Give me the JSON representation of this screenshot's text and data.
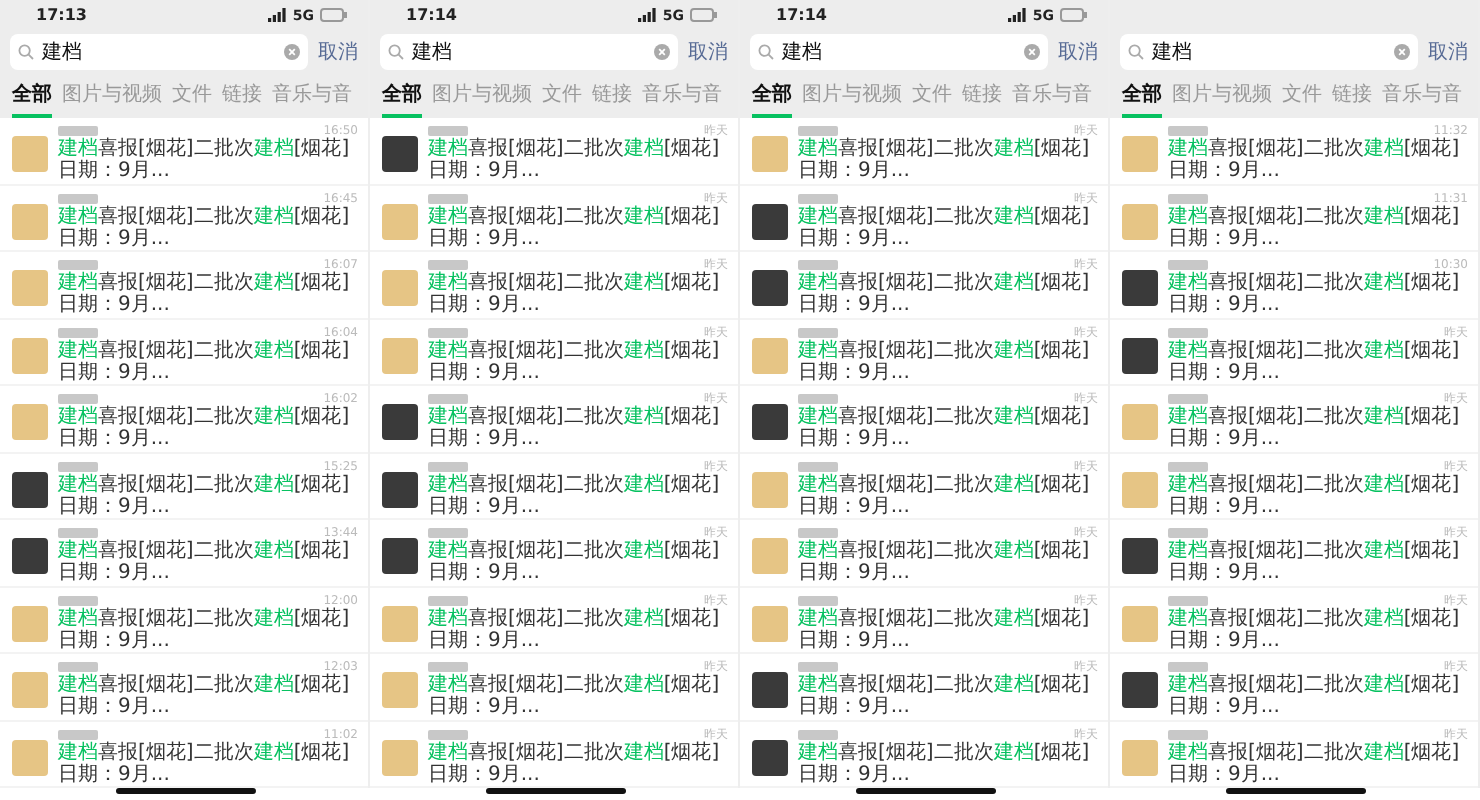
{
  "panels": [
    {
      "time": "17:13",
      "network": "5G",
      "query": "建档",
      "cancel": "取消",
      "tabs": [
        {
          "label": "全部",
          "selected": true
        },
        {
          "label": "图片与视频",
          "selected": false
        },
        {
          "label": "文件",
          "selected": false
        },
        {
          "label": "链接",
          "selected": false
        },
        {
          "label": "音乐与音",
          "selected": false
        }
      ],
      "results": [
        {
          "color": "#e6c585",
          "time": "16:50",
          "message": [
            {
              "text": "建档",
              "hit": true
            },
            {
              "text": "喜报[烟花]二批次",
              "hit": false
            },
            {
              "text": "建档",
              "hit": true
            },
            {
              "text": "[烟花]日期：9月...",
              "hit": false
            }
          ]
        },
        {
          "color": "#e6c585",
          "time": "16:45",
          "message": [
            {
              "text": "建档",
              "hit": true
            },
            {
              "text": "喜报[烟花]二批次",
              "hit": false
            },
            {
              "text": "建档",
              "hit": true
            },
            {
              "text": "[烟花]日期：9月...",
              "hit": false
            }
          ]
        },
        {
          "color": "#e6c585",
          "time": "16:07",
          "message": [
            {
              "text": "建档",
              "hit": true
            },
            {
              "text": "喜报[烟花]二批次",
              "hit": false
            },
            {
              "text": "建档",
              "hit": true
            },
            {
              "text": "[烟花]日期：9月...",
              "hit": false
            }
          ]
        },
        {
          "color": "#e6c585",
          "time": "16:04",
          "message": [
            {
              "text": "建档",
              "hit": true
            },
            {
              "text": "喜报[烟花]二批次",
              "hit": false
            },
            {
              "text": "建档",
              "hit": true
            },
            {
              "text": "[烟花]日期：9月...",
              "hit": false
            }
          ]
        },
        {
          "color": "#e6c585",
          "time": "16:02",
          "message": [
            {
              "text": "建档",
              "hit": true
            },
            {
              "text": "喜报[烟花]二批次",
              "hit": false
            },
            {
              "text": "建档",
              "hit": true
            },
            {
              "text": "[烟花]日期：9月...",
              "hit": false
            }
          ]
        },
        {
          "color": "#3a3a3a",
          "time": "15:25",
          "message": [
            {
              "text": "建档",
              "hit": true
            },
            {
              "text": "喜报[烟花]二批次",
              "hit": false
            },
            {
              "text": "建档",
              "hit": true
            },
            {
              "text": "[烟花]日期：9月...",
              "hit": false
            }
          ]
        },
        {
          "color": "#3a3a3a",
          "time": "13:44",
          "message": [
            {
              "text": "建档",
              "hit": true
            },
            {
              "text": "喜报[烟花]二批次",
              "hit": false
            },
            {
              "text": "建档",
              "hit": true
            },
            {
              "text": "[烟花]日期：9月...",
              "hit": false
            }
          ]
        },
        {
          "color": "#e6c585",
          "time": "12:00",
          "message": [
            {
              "text": "建档",
              "hit": true
            },
            {
              "text": "喜报[烟花]二批次",
              "hit": false
            },
            {
              "text": "建档",
              "hit": true
            },
            {
              "text": "[烟花]日期：9月...",
              "hit": false
            }
          ]
        },
        {
          "color": "#e6c585",
          "time": "12:03",
          "message": [
            {
              "text": "建档",
              "hit": true
            },
            {
              "text": "喜报[烟花]二批次",
              "hit": false
            },
            {
              "text": "建档",
              "hit": true
            },
            {
              "text": "[烟花]日期：9月...",
              "hit": false
            }
          ]
        },
        {
          "color": "#e6c585",
          "time": "11:02",
          "message": [
            {
              "text": "建档",
              "hit": true
            },
            {
              "text": "喜报[烟花]二批次",
              "hit": false
            },
            {
              "text": "建档",
              "hit": true
            },
            {
              "text": "[烟花]日期：9月...",
              "hit": false
            }
          ]
        }
      ]
    },
    {
      "time": "17:14",
      "network": "5G",
      "query": "建档",
      "cancel": "取消",
      "tabs": [
        {
          "label": "全部",
          "selected": true
        },
        {
          "label": "图片与视频",
          "selected": false
        },
        {
          "label": "文件",
          "selected": false
        },
        {
          "label": "链接",
          "selected": false
        },
        {
          "label": "音乐与音",
          "selected": false
        }
      ],
      "results": [
        {
          "color": "#3a3a3a",
          "time": "昨天",
          "message": [
            {
              "text": "建档",
              "hit": true
            },
            {
              "text": "喜报[烟花]二批次",
              "hit": false
            },
            {
              "text": "建档",
              "hit": true
            },
            {
              "text": "[烟花]日期：9月...",
              "hit": false
            }
          ]
        },
        {
          "color": "#e6c585",
          "time": "昨天",
          "message": [
            {
              "text": "建档",
              "hit": true
            },
            {
              "text": "喜报[烟花]二批次",
              "hit": false
            },
            {
              "text": "建档",
              "hit": true
            },
            {
              "text": "[烟花]日期：9月...",
              "hit": false
            }
          ]
        },
        {
          "color": "#e6c585",
          "time": "昨天",
          "message": [
            {
              "text": "建档",
              "hit": true
            },
            {
              "text": "喜报[烟花]二批次",
              "hit": false
            },
            {
              "text": "建档",
              "hit": true
            },
            {
              "text": "[烟花]日期：9月...",
              "hit": false
            }
          ]
        },
        {
          "color": "#e6c585",
          "time": "昨天",
          "message": [
            {
              "text": "建档",
              "hit": true
            },
            {
              "text": "喜报[烟花]二批次",
              "hit": false
            },
            {
              "text": "建档",
              "hit": true
            },
            {
              "text": "[烟花]日期：9月...",
              "hit": false
            }
          ]
        },
        {
          "color": "#3a3a3a",
          "time": "昨天",
          "message": [
            {
              "text": "建档",
              "hit": true
            },
            {
              "text": "喜报[烟花]二批次",
              "hit": false
            },
            {
              "text": "建档",
              "hit": true
            },
            {
              "text": "[烟花]日期：9月...",
              "hit": false
            }
          ]
        },
        {
          "color": "#3a3a3a",
          "time": "昨天",
          "message": [
            {
              "text": "建档",
              "hit": true
            },
            {
              "text": "喜报[烟花]二批次",
              "hit": false
            },
            {
              "text": "建档",
              "hit": true
            },
            {
              "text": "[烟花]日期：9月...",
              "hit": false
            }
          ]
        },
        {
          "color": "#3a3a3a",
          "time": "昨天",
          "message": [
            {
              "text": "建档",
              "hit": true
            },
            {
              "text": "喜报[烟花]二批次",
              "hit": false
            },
            {
              "text": "建档",
              "hit": true
            },
            {
              "text": "[烟花]日期：9月...",
              "hit": false
            }
          ]
        },
        {
          "color": "#e6c585",
          "time": "昨天",
          "message": [
            {
              "text": "建档",
              "hit": true
            },
            {
              "text": "喜报[烟花]二批次",
              "hit": false
            },
            {
              "text": "建档",
              "hit": true
            },
            {
              "text": "[烟花]日期：9月...",
              "hit": false
            }
          ]
        },
        {
          "color": "#e6c585",
          "time": "昨天",
          "message": [
            {
              "text": "建档",
              "hit": true
            },
            {
              "text": "喜报[烟花]二批次",
              "hit": false
            },
            {
              "text": "建档",
              "hit": true
            },
            {
              "text": "[烟花]日期：9月...",
              "hit": false
            }
          ]
        },
        {
          "color": "#e6c585",
          "time": "昨天",
          "message": [
            {
              "text": "建档",
              "hit": true
            },
            {
              "text": "喜报[烟花]二批次",
              "hit": false
            },
            {
              "text": "建档",
              "hit": true
            },
            {
              "text": "[烟花]日期：9月...",
              "hit": false
            }
          ]
        }
      ]
    },
    {
      "time": "17:14",
      "network": "5G",
      "query": "建档",
      "cancel": "取消",
      "tabs": [
        {
          "label": "全部",
          "selected": true
        },
        {
          "label": "图片与视频",
          "selected": false
        },
        {
          "label": "文件",
          "selected": false
        },
        {
          "label": "链接",
          "selected": false
        },
        {
          "label": "音乐与音",
          "selected": false
        }
      ],
      "results": [
        {
          "color": "#e6c585",
          "time": "昨天",
          "message": [
            {
              "text": "建档",
              "hit": true
            },
            {
              "text": "喜报[烟花]二批次",
              "hit": false
            },
            {
              "text": "建档",
              "hit": true
            },
            {
              "text": "[烟花]日期：9月...",
              "hit": false
            }
          ]
        },
        {
          "color": "#3a3a3a",
          "time": "昨天",
          "message": [
            {
              "text": "建档",
              "hit": true
            },
            {
              "text": "喜报[烟花]二批次",
              "hit": false
            },
            {
              "text": "建档",
              "hit": true
            },
            {
              "text": "[烟花]日期：9月...",
              "hit": false
            }
          ]
        },
        {
          "color": "#3a3a3a",
          "time": "昨天",
          "message": [
            {
              "text": "建档",
              "hit": true
            },
            {
              "text": "喜报[烟花]二批次",
              "hit": false
            },
            {
              "text": "建档",
              "hit": true
            },
            {
              "text": "[烟花]日期：9月...",
              "hit": false
            }
          ]
        },
        {
          "color": "#e6c585",
          "time": "昨天",
          "message": [
            {
              "text": "建档",
              "hit": true
            },
            {
              "text": "喜报[烟花]二批次",
              "hit": false
            },
            {
              "text": "建档",
              "hit": true
            },
            {
              "text": "[烟花]日期：9月...",
              "hit": false
            }
          ]
        },
        {
          "color": "#3a3a3a",
          "time": "昨天",
          "message": [
            {
              "text": "建档",
              "hit": true
            },
            {
              "text": "喜报[烟花]二批次",
              "hit": false
            },
            {
              "text": "建档",
              "hit": true
            },
            {
              "text": "[烟花]日期：9月...",
              "hit": false
            }
          ]
        },
        {
          "color": "#e6c585",
          "time": "昨天",
          "message": [
            {
              "text": "建档",
              "hit": true
            },
            {
              "text": "喜报[烟花]二批次",
              "hit": false
            },
            {
              "text": "建档",
              "hit": true
            },
            {
              "text": "[烟花]日期：9月...",
              "hit": false
            }
          ]
        },
        {
          "color": "#e6c585",
          "time": "昨天",
          "message": [
            {
              "text": "建档",
              "hit": true
            },
            {
              "text": "喜报[烟花]二批次",
              "hit": false
            },
            {
              "text": "建档",
              "hit": true
            },
            {
              "text": "[烟花]日期：9月...",
              "hit": false
            }
          ]
        },
        {
          "color": "#e6c585",
          "time": "昨天",
          "message": [
            {
              "text": "建档",
              "hit": true
            },
            {
              "text": "喜报[烟花]二批次",
              "hit": false
            },
            {
              "text": "建档",
              "hit": true
            },
            {
              "text": "[烟花]日期：9月...",
              "hit": false
            }
          ]
        },
        {
          "color": "#3a3a3a",
          "time": "昨天",
          "message": [
            {
              "text": "建档",
              "hit": true
            },
            {
              "text": "喜报[烟花]二批次",
              "hit": false
            },
            {
              "text": "建档",
              "hit": true
            },
            {
              "text": "[烟花]日期：9月...",
              "hit": false
            }
          ]
        },
        {
          "color": "#3a3a3a",
          "time": "昨天",
          "message": [
            {
              "text": "建档",
              "hit": true
            },
            {
              "text": "喜报[烟花]二批次",
              "hit": false
            },
            {
              "text": "建档",
              "hit": true
            },
            {
              "text": "[烟花]日期：9月...",
              "hit": false
            }
          ]
        }
      ]
    },
    {
      "query": "建档",
      "cancel": "取消",
      "tabs": [
        {
          "label": "全部",
          "selected": true
        },
        {
          "label": "图片与视频",
          "selected": false
        },
        {
          "label": "文件",
          "selected": false
        },
        {
          "label": "链接",
          "selected": false
        },
        {
          "label": "音乐与音",
          "selected": false
        }
      ],
      "results": [
        {
          "color": "#e6c585",
          "time": "11:32",
          "message": [
            {
              "text": "建档",
              "hit": true
            },
            {
              "text": "喜报[烟花]二批次",
              "hit": false
            },
            {
              "text": "建档",
              "hit": true
            },
            {
              "text": "[烟花]日期：9月...",
              "hit": false
            }
          ]
        },
        {
          "color": "#e6c585",
          "time": "11:31",
          "message": [
            {
              "text": "建档",
              "hit": true
            },
            {
              "text": "喜报[烟花]二批次",
              "hit": false
            },
            {
              "text": "建档",
              "hit": true
            },
            {
              "text": "[烟花]日期：9月...",
              "hit": false
            }
          ]
        },
        {
          "color": "#3a3a3a",
          "time": "10:30",
          "message": [
            {
              "text": "建档",
              "hit": true
            },
            {
              "text": "喜报[烟花]二批次",
              "hit": false
            },
            {
              "text": "建档",
              "hit": true
            },
            {
              "text": "[烟花]日期：9月...",
              "hit": false
            }
          ]
        },
        {
          "color": "#3a3a3a",
          "time": "昨天",
          "message": [
            {
              "text": "建档",
              "hit": true
            },
            {
              "text": "喜报[烟花]二批次",
              "hit": false
            },
            {
              "text": "建档",
              "hit": true
            },
            {
              "text": "[烟花]日期：9月...",
              "hit": false
            }
          ]
        },
        {
          "color": "#e6c585",
          "time": "昨天",
          "message": [
            {
              "text": "建档",
              "hit": true
            },
            {
              "text": "喜报[烟花]二批次",
              "hit": false
            },
            {
              "text": "建档",
              "hit": true
            },
            {
              "text": "[烟花]日期：9月...",
              "hit": false
            }
          ]
        },
        {
          "color": "#e6c585",
          "time": "昨天",
          "message": [
            {
              "text": "建档",
              "hit": true
            },
            {
              "text": "喜报[烟花]二批次",
              "hit": false
            },
            {
              "text": "建档",
              "hit": true
            },
            {
              "text": "[烟花]日期：9月...",
              "hit": false
            }
          ]
        },
        {
          "color": "#3a3a3a",
          "time": "昨天",
          "message": [
            {
              "text": "建档",
              "hit": true
            },
            {
              "text": "喜报[烟花]二批次",
              "hit": false
            },
            {
              "text": "建档",
              "hit": true
            },
            {
              "text": "[烟花]日期：9月...",
              "hit": false
            }
          ]
        },
        {
          "color": "#e6c585",
          "time": "昨天",
          "message": [
            {
              "text": "建档",
              "hit": true
            },
            {
              "text": "喜报[烟花]二批次",
              "hit": false
            },
            {
              "text": "建档",
              "hit": true
            },
            {
              "text": "[烟花]日期：9月...",
              "hit": false
            }
          ]
        },
        {
          "color": "#3a3a3a",
          "time": "昨天",
          "message": [
            {
              "text": "建档",
              "hit": true
            },
            {
              "text": "喜报[烟花]二批次",
              "hit": false
            },
            {
              "text": "建档",
              "hit": true
            },
            {
              "text": "[烟花]日期：9月...",
              "hit": false
            }
          ]
        },
        {
          "color": "#e6c585",
          "time": "昨天",
          "message": [
            {
              "text": "建档",
              "hit": true
            },
            {
              "text": "喜报[烟花]二批次",
              "hit": false
            },
            {
              "text": "建档",
              "hit": true
            },
            {
              "text": "[烟花]日期：9月...",
              "hit": false
            }
          ]
        }
      ]
    }
  ]
}
